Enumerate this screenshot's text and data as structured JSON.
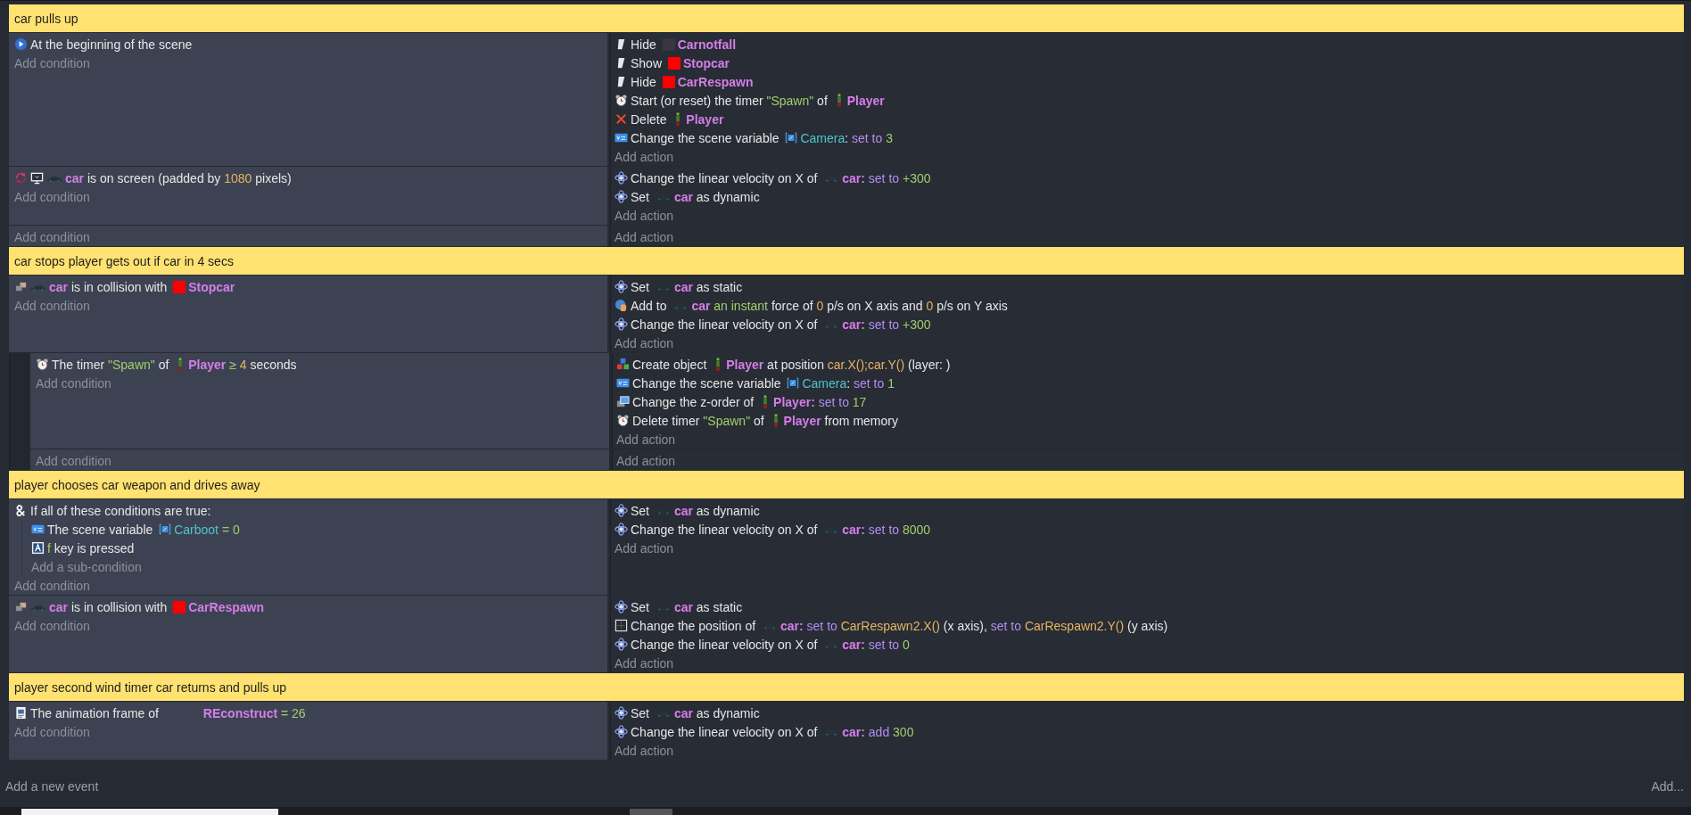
{
  "events": [
    {
      "kind": "comment",
      "text": "car pulls up"
    },
    {
      "kind": "event",
      "conditions": [
        {
          "icons": [
            {
              "kind": "play"
            }
          ],
          "parts": [
            {
              "kind": "text",
              "text": "At the beginning of the scene"
            }
          ]
        }
      ],
      "add_condition": "Add condition",
      "actions": [
        {
          "icons": [
            {
              "kind": "visibility"
            }
          ],
          "parts": [
            {
              "kind": "text",
              "text": "Hide "
            },
            {
              "kind": "swatch",
              "color": "#3a3541"
            },
            {
              "kind": "object",
              "text": "Carnotfall"
            }
          ]
        },
        {
          "icons": [
            {
              "kind": "visibility"
            }
          ],
          "parts": [
            {
              "kind": "text",
              "text": "Show "
            },
            {
              "kind": "swatch",
              "color": "#ff0000"
            },
            {
              "kind": "object",
              "text": "Stopcar"
            }
          ]
        },
        {
          "icons": [
            {
              "kind": "visibility"
            }
          ],
          "parts": [
            {
              "kind": "text",
              "text": "Hide "
            },
            {
              "kind": "swatch",
              "color": "#ff0000"
            },
            {
              "kind": "object",
              "text": "CarRespawn"
            }
          ]
        },
        {
          "icons": [
            {
              "kind": "timer"
            }
          ],
          "parts": [
            {
              "kind": "text",
              "text": "Start (or reset) the timer "
            },
            {
              "kind": "string",
              "text": "\"Spawn\""
            },
            {
              "kind": "text",
              "text": " of "
            },
            {
              "kind": "player"
            },
            {
              "kind": "object",
              "text": "Player"
            }
          ]
        },
        {
          "icons": [
            {
              "kind": "delete"
            }
          ],
          "parts": [
            {
              "kind": "text",
              "text": "Delete "
            },
            {
              "kind": "player"
            },
            {
              "kind": "object",
              "text": "Player"
            }
          ]
        },
        {
          "icons": [
            {
              "kind": "variable"
            }
          ],
          "parts": [
            {
              "kind": "text",
              "text": "Change the scene variable "
            },
            {
              "kind": "var"
            },
            {
              "kind": "variable",
              "text": "Camera"
            },
            {
              "kind": "text",
              "text": ": "
            },
            {
              "kind": "op",
              "text": "set to "
            },
            {
              "kind": "value",
              "text": "3"
            }
          ]
        }
      ],
      "add_action": "Add action"
    },
    {
      "kind": "event",
      "conditions": [
        {
          "icons": [
            {
              "kind": "arrows"
            },
            {
              "kind": "monitor"
            }
          ],
          "parts": [
            {
              "kind": "car"
            },
            {
              "kind": "object",
              "text": "car"
            },
            {
              "kind": "text",
              "text": " is on screen (padded by "
            },
            {
              "kind": "number",
              "text": "1080"
            },
            {
              "kind": "text",
              "text": " pixels)"
            }
          ]
        }
      ],
      "add_condition": "Add condition",
      "actions": [
        {
          "icons": [
            {
              "kind": "physics"
            }
          ],
          "parts": [
            {
              "kind": "text",
              "text": "Change the linear velocity on X of "
            },
            {
              "kind": "car"
            },
            {
              "kind": "object",
              "text": "car:"
            },
            {
              "kind": "op",
              "text": " set to "
            },
            {
              "kind": "value",
              "text": "+300"
            }
          ]
        },
        {
          "icons": [
            {
              "kind": "physics"
            }
          ],
          "parts": [
            {
              "kind": "text",
              "text": "Set "
            },
            {
              "kind": "car"
            },
            {
              "kind": "object",
              "text": "car"
            },
            {
              "kind": "text",
              "text": " as dynamic"
            }
          ]
        }
      ],
      "add_action": "Add action"
    },
    {
      "kind": "event",
      "add_condition": "Add condition",
      "add_action": "Add action"
    },
    {
      "kind": "comment",
      "text": "car stops player gets out if car in 4 secs"
    },
    {
      "kind": "event",
      "conditions": [
        {
          "icons": [
            {
              "kind": "collision"
            }
          ],
          "parts": [
            {
              "kind": "car"
            },
            {
              "kind": "object",
              "text": "car"
            },
            {
              "kind": "text",
              "text": " is in collision with "
            },
            {
              "kind": "swatch",
              "color": "#ff0000"
            },
            {
              "kind": "object",
              "text": "Stopcar"
            }
          ]
        }
      ],
      "add_condition": "Add condition",
      "actions": [
        {
          "icons": [
            {
              "kind": "physics"
            }
          ],
          "parts": [
            {
              "kind": "text",
              "text": "Set "
            },
            {
              "kind": "car"
            },
            {
              "kind": "object",
              "text": "car"
            },
            {
              "kind": "text",
              "text": " as static"
            }
          ]
        },
        {
          "icons": [
            {
              "kind": "force"
            }
          ],
          "parts": [
            {
              "kind": "text",
              "text": "Add to "
            },
            {
              "kind": "car"
            },
            {
              "kind": "object",
              "text": "car"
            },
            {
              "kind": "value",
              "text": " an instant"
            },
            {
              "kind": "text",
              "text": " force of "
            },
            {
              "kind": "number",
              "text": "0"
            },
            {
              "kind": "text",
              "text": " p/s on X axis and "
            },
            {
              "kind": "number",
              "text": "0"
            },
            {
              "kind": "text",
              "text": " p/s on Y axis"
            }
          ]
        },
        {
          "icons": [
            {
              "kind": "physics"
            }
          ],
          "parts": [
            {
              "kind": "text",
              "text": "Change the linear velocity on X of "
            },
            {
              "kind": "car"
            },
            {
              "kind": "object",
              "text": "car:"
            },
            {
              "kind": "op",
              "text": " set to "
            },
            {
              "kind": "value",
              "text": "+300"
            }
          ]
        }
      ],
      "add_action": "Add action",
      "children": [
        {
          "kind": "event",
          "conditions": [
            {
              "icons": [
                {
                  "kind": "timer"
                }
              ],
              "parts": [
                {
                  "kind": "text",
                  "text": "The timer "
                },
                {
                  "kind": "string",
                  "text": "\"Spawn\""
                },
                {
                  "kind": "text",
                  "text": " of "
                },
                {
                  "kind": "player"
                },
                {
                  "kind": "object",
                  "text": "Player"
                },
                {
                  "kind": "value",
                  "text": " ≥ "
                },
                {
                  "kind": "number",
                  "text": "4"
                },
                {
                  "kind": "text",
                  "text": " seconds"
                }
              ]
            }
          ],
          "add_condition": "Add condition",
          "actions": [
            {
              "icons": [
                {
                  "kind": "create"
                }
              ],
              "parts": [
                {
                  "kind": "text",
                  "text": "Create object "
                },
                {
                  "kind": "player"
                },
                {
                  "kind": "object",
                  "text": "Player"
                },
                {
                  "kind": "text",
                  "text": " at position "
                },
                {
                  "kind": "number",
                  "text": "car.X();car.Y()"
                },
                {
                  "kind": "text",
                  "text": " (layer: )"
                }
              ]
            },
            {
              "icons": [
                {
                  "kind": "variable"
                }
              ],
              "parts": [
                {
                  "kind": "text",
                  "text": "Change the scene variable "
                },
                {
                  "kind": "var"
                },
                {
                  "kind": "variable",
                  "text": "Camera"
                },
                {
                  "kind": "text",
                  "text": ": "
                },
                {
                  "kind": "op",
                  "text": "set to "
                },
                {
                  "kind": "value",
                  "text": "1"
                }
              ]
            },
            {
              "icons": [
                {
                  "kind": "zorder"
                }
              ],
              "parts": [
                {
                  "kind": "text",
                  "text": "Change the z-order of "
                },
                {
                  "kind": "player"
                },
                {
                  "kind": "object",
                  "text": "Player:"
                },
                {
                  "kind": "op",
                  "text": " set to "
                },
                {
                  "kind": "value",
                  "text": "17"
                }
              ]
            },
            {
              "icons": [
                {
                  "kind": "timer"
                }
              ],
              "parts": [
                {
                  "kind": "text",
                  "text": "Delete timer "
                },
                {
                  "kind": "string",
                  "text": "\"Spawn\""
                },
                {
                  "kind": "text",
                  "text": " of "
                },
                {
                  "kind": "player"
                },
                {
                  "kind": "object",
                  "text": "Player"
                },
                {
                  "kind": "text",
                  "text": " from memory"
                }
              ]
            }
          ],
          "add_action": "Add action"
        },
        {
          "kind": "event",
          "add_condition": "Add condition",
          "add_action": "Add action"
        }
      ]
    },
    {
      "kind": "comment",
      "text": "player chooses car weapon and drives away"
    },
    {
      "kind": "event",
      "conditions": [
        {
          "icons": [
            {
              "kind": "and"
            }
          ],
          "parts": [
            {
              "kind": "text",
              "text": "If all of these conditions are true:"
            }
          ],
          "subconditions": [
            {
              "icons": [
                {
                  "kind": "variable"
                }
              ],
              "parts": [
                {
                  "kind": "text",
                  "text": "The scene variable "
                },
                {
                  "kind": "var"
                },
                {
                  "kind": "variable",
                  "text": "Carboot"
                },
                {
                  "kind": "value",
                  "text": " = 0"
                }
              ]
            },
            {
              "icons": [
                {
                  "kind": "key"
                }
              ],
              "parts": [
                {
                  "kind": "value",
                  "text": "f"
                },
                {
                  "kind": "text",
                  "text": " key is pressed"
                }
              ]
            }
          ],
          "add_subcondition": "Add a sub-condition"
        }
      ],
      "add_condition": "Add condition",
      "actions": [
        {
          "icons": [
            {
              "kind": "physics"
            }
          ],
          "parts": [
            {
              "kind": "text",
              "text": "Set "
            },
            {
              "kind": "car"
            },
            {
              "kind": "object",
              "text": "car"
            },
            {
              "kind": "text",
              "text": " as dynamic"
            }
          ]
        },
        {
          "icons": [
            {
              "kind": "physics"
            }
          ],
          "parts": [
            {
              "kind": "text",
              "text": "Change the linear velocity on X of "
            },
            {
              "kind": "car"
            },
            {
              "kind": "object",
              "text": "car:"
            },
            {
              "kind": "op",
              "text": " set to "
            },
            {
              "kind": "value",
              "text": "8000"
            }
          ]
        }
      ],
      "add_action": "Add action"
    },
    {
      "kind": "event",
      "conditions": [
        {
          "icons": [
            {
              "kind": "collision"
            }
          ],
          "parts": [
            {
              "kind": "car"
            },
            {
              "kind": "object",
              "text": "car"
            },
            {
              "kind": "text",
              "text": " is in collision with "
            },
            {
              "kind": "swatch",
              "color": "#ff0000"
            },
            {
              "kind": "object",
              "text": "CarRespawn"
            }
          ]
        }
      ],
      "add_condition": "Add condition",
      "actions": [
        {
          "icons": [
            {
              "kind": "physics"
            }
          ],
          "parts": [
            {
              "kind": "text",
              "text": "Set "
            },
            {
              "kind": "car"
            },
            {
              "kind": "object",
              "text": "car"
            },
            {
              "kind": "text",
              "text": " as static"
            }
          ]
        },
        {
          "icons": [
            {
              "kind": "position"
            }
          ],
          "parts": [
            {
              "kind": "text",
              "text": "Change the position of "
            },
            {
              "kind": "car"
            },
            {
              "kind": "object",
              "text": "car:"
            },
            {
              "kind": "op",
              "text": " set to "
            },
            {
              "kind": "number",
              "text": "CarRespawn2.X()"
            },
            {
              "kind": "text",
              "text": " (x axis), "
            },
            {
              "kind": "op",
              "text": "set to "
            },
            {
              "kind": "number",
              "text": "CarRespawn2.Y()"
            },
            {
              "kind": "text",
              "text": " (y axis)"
            }
          ]
        },
        {
          "icons": [
            {
              "kind": "physics"
            }
          ],
          "parts": [
            {
              "kind": "text",
              "text": "Change the linear velocity on X of "
            },
            {
              "kind": "car"
            },
            {
              "kind": "object",
              "text": "car:"
            },
            {
              "kind": "op",
              "text": " set to "
            },
            {
              "kind": "value",
              "text": "0"
            }
          ]
        }
      ],
      "add_action": "Add action"
    },
    {
      "kind": "comment",
      "text": "player second wind timer car returns and pulls up"
    },
    {
      "kind": "event",
      "conditions": [
        {
          "icons": [
            {
              "kind": "animation"
            }
          ],
          "parts": [
            {
              "kind": "text",
              "text": "The animation frame of "
            },
            {
              "kind": "gap"
            },
            {
              "kind": "object",
              "text": "REconstruct"
            },
            {
              "kind": "value",
              "text": " = 26"
            }
          ]
        }
      ],
      "add_condition": "Add condition",
      "actions": [
        {
          "icons": [
            {
              "kind": "physics"
            }
          ],
          "parts": [
            {
              "kind": "text",
              "text": "Set "
            },
            {
              "kind": "car"
            },
            {
              "kind": "object",
              "text": "car"
            },
            {
              "kind": "text",
              "text": " as dynamic"
            }
          ]
        },
        {
          "icons": [
            {
              "kind": "physics"
            }
          ],
          "parts": [
            {
              "kind": "text",
              "text": "Change the linear velocity on X of "
            },
            {
              "kind": "car"
            },
            {
              "kind": "object",
              "text": "car:"
            },
            {
              "kind": "op",
              "text": " add "
            },
            {
              "kind": "value",
              "text": "300"
            }
          ]
        }
      ],
      "add_action": "Add action"
    }
  ],
  "footer": {
    "add_event": "Add a new event",
    "add_menu": "Add..."
  }
}
